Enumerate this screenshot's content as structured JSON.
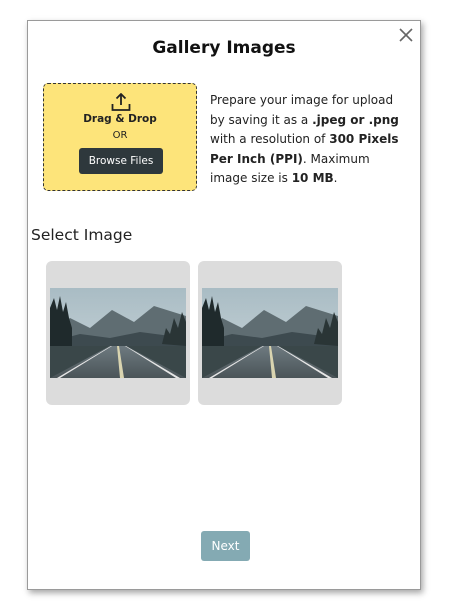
{
  "dialog": {
    "title": "Gallery Images",
    "close_icon": "close-icon"
  },
  "dropzone": {
    "icon": "upload-icon",
    "title": "Drag & Drop",
    "or_text": "OR",
    "browse_label": "Browse Files",
    "background_color": "#fde47a"
  },
  "info": {
    "part1": "Prepare your image for upload by saving it as a ",
    "formats": ".jpeg or .png",
    "part2": " with a resolution of ",
    "resolution": "300 Pixels Per Inch (PPI)",
    "part3": ". Maximum image size is ",
    "max_size": "10 MB",
    "part4": "."
  },
  "gallery": {
    "section_label": "Select Image",
    "images": [
      {
        "subject": "misty mountain road"
      },
      {
        "subject": "misty mountain road"
      }
    ]
  },
  "footer": {
    "next_label": "Next",
    "next_color": "#84aab3"
  }
}
